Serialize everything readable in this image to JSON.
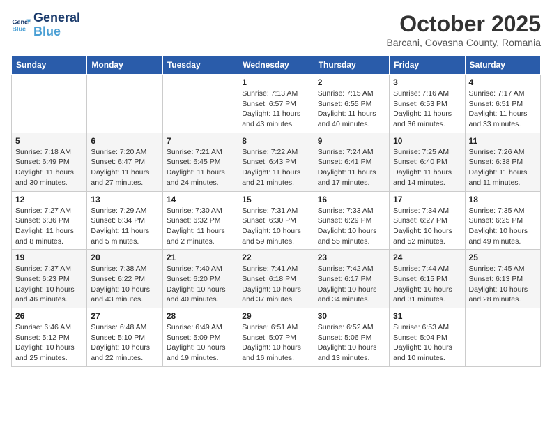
{
  "header": {
    "logo_line1": "General",
    "logo_line2": "Blue",
    "month": "October 2025",
    "location": "Barcani, Covasna County, Romania"
  },
  "weekdays": [
    "Sunday",
    "Monday",
    "Tuesday",
    "Wednesday",
    "Thursday",
    "Friday",
    "Saturday"
  ],
  "weeks": [
    [
      {
        "day": "",
        "info": ""
      },
      {
        "day": "",
        "info": ""
      },
      {
        "day": "",
        "info": ""
      },
      {
        "day": "1",
        "info": "Sunrise: 7:13 AM\nSunset: 6:57 PM\nDaylight: 11 hours\nand 43 minutes."
      },
      {
        "day": "2",
        "info": "Sunrise: 7:15 AM\nSunset: 6:55 PM\nDaylight: 11 hours\nand 40 minutes."
      },
      {
        "day": "3",
        "info": "Sunrise: 7:16 AM\nSunset: 6:53 PM\nDaylight: 11 hours\nand 36 minutes."
      },
      {
        "day": "4",
        "info": "Sunrise: 7:17 AM\nSunset: 6:51 PM\nDaylight: 11 hours\nand 33 minutes."
      }
    ],
    [
      {
        "day": "5",
        "info": "Sunrise: 7:18 AM\nSunset: 6:49 PM\nDaylight: 11 hours\nand 30 minutes."
      },
      {
        "day": "6",
        "info": "Sunrise: 7:20 AM\nSunset: 6:47 PM\nDaylight: 11 hours\nand 27 minutes."
      },
      {
        "day": "7",
        "info": "Sunrise: 7:21 AM\nSunset: 6:45 PM\nDaylight: 11 hours\nand 24 minutes."
      },
      {
        "day": "8",
        "info": "Sunrise: 7:22 AM\nSunset: 6:43 PM\nDaylight: 11 hours\nand 21 minutes."
      },
      {
        "day": "9",
        "info": "Sunrise: 7:24 AM\nSunset: 6:41 PM\nDaylight: 11 hours\nand 17 minutes."
      },
      {
        "day": "10",
        "info": "Sunrise: 7:25 AM\nSunset: 6:40 PM\nDaylight: 11 hours\nand 14 minutes."
      },
      {
        "day": "11",
        "info": "Sunrise: 7:26 AM\nSunset: 6:38 PM\nDaylight: 11 hours\nand 11 minutes."
      }
    ],
    [
      {
        "day": "12",
        "info": "Sunrise: 7:27 AM\nSunset: 6:36 PM\nDaylight: 11 hours\nand 8 minutes."
      },
      {
        "day": "13",
        "info": "Sunrise: 7:29 AM\nSunset: 6:34 PM\nDaylight: 11 hours\nand 5 minutes."
      },
      {
        "day": "14",
        "info": "Sunrise: 7:30 AM\nSunset: 6:32 PM\nDaylight: 11 hours\nand 2 minutes."
      },
      {
        "day": "15",
        "info": "Sunrise: 7:31 AM\nSunset: 6:30 PM\nDaylight: 10 hours\nand 59 minutes."
      },
      {
        "day": "16",
        "info": "Sunrise: 7:33 AM\nSunset: 6:29 PM\nDaylight: 10 hours\nand 55 minutes."
      },
      {
        "day": "17",
        "info": "Sunrise: 7:34 AM\nSunset: 6:27 PM\nDaylight: 10 hours\nand 52 minutes."
      },
      {
        "day": "18",
        "info": "Sunrise: 7:35 AM\nSunset: 6:25 PM\nDaylight: 10 hours\nand 49 minutes."
      }
    ],
    [
      {
        "day": "19",
        "info": "Sunrise: 7:37 AM\nSunset: 6:23 PM\nDaylight: 10 hours\nand 46 minutes."
      },
      {
        "day": "20",
        "info": "Sunrise: 7:38 AM\nSunset: 6:22 PM\nDaylight: 10 hours\nand 43 minutes."
      },
      {
        "day": "21",
        "info": "Sunrise: 7:40 AM\nSunset: 6:20 PM\nDaylight: 10 hours\nand 40 minutes."
      },
      {
        "day": "22",
        "info": "Sunrise: 7:41 AM\nSunset: 6:18 PM\nDaylight: 10 hours\nand 37 minutes."
      },
      {
        "day": "23",
        "info": "Sunrise: 7:42 AM\nSunset: 6:17 PM\nDaylight: 10 hours\nand 34 minutes."
      },
      {
        "day": "24",
        "info": "Sunrise: 7:44 AM\nSunset: 6:15 PM\nDaylight: 10 hours\nand 31 minutes."
      },
      {
        "day": "25",
        "info": "Sunrise: 7:45 AM\nSunset: 6:13 PM\nDaylight: 10 hours\nand 28 minutes."
      }
    ],
    [
      {
        "day": "26",
        "info": "Sunrise: 6:46 AM\nSunset: 5:12 PM\nDaylight: 10 hours\nand 25 minutes."
      },
      {
        "day": "27",
        "info": "Sunrise: 6:48 AM\nSunset: 5:10 PM\nDaylight: 10 hours\nand 22 minutes."
      },
      {
        "day": "28",
        "info": "Sunrise: 6:49 AM\nSunset: 5:09 PM\nDaylight: 10 hours\nand 19 minutes."
      },
      {
        "day": "29",
        "info": "Sunrise: 6:51 AM\nSunset: 5:07 PM\nDaylight: 10 hours\nand 16 minutes."
      },
      {
        "day": "30",
        "info": "Sunrise: 6:52 AM\nSunset: 5:06 PM\nDaylight: 10 hours\nand 13 minutes."
      },
      {
        "day": "31",
        "info": "Sunrise: 6:53 AM\nSunset: 5:04 PM\nDaylight: 10 hours\nand 10 minutes."
      },
      {
        "day": "",
        "info": ""
      }
    ]
  ]
}
